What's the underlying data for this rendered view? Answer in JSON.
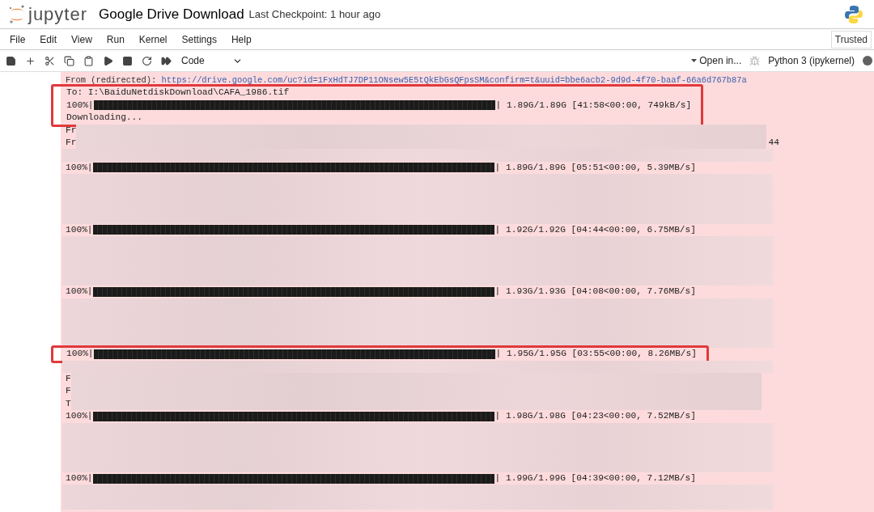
{
  "header": {
    "logo_text": "jupyter",
    "title": "Google Drive Download",
    "checkpoint": "Last Checkpoint: 1 hour ago"
  },
  "menu": [
    "File",
    "Edit",
    "View",
    "Run",
    "Kernel",
    "Settings",
    "Help"
  ],
  "trusted": "Trusted",
  "toolbar": {
    "cell_type": "Code",
    "open_in": "Open in...",
    "kernel": "Python 3 (ipykernel)",
    "kernel_busy": true
  },
  "output": [
    {
      "kind": "link",
      "prefix": "From (redirected): ",
      "url": "https://drive.google.com/uc?id=1FxHdTJ7DP11ONsew5E5tQkEbGsQFpsSM&confirm=t&uuid=bbe6acb2-9d9d-4f70-baaf-66a6d767b87a",
      "highlighted": false
    },
    {
      "kind": "text",
      "text": "To: I:\\BaiduNetdiskDownload\\CAFA_1986.tif",
      "highlighted": true
    },
    {
      "kind": "progress",
      "percent": "100%|",
      "level": 1,
      "stats": "| 1.89G/1.89G [41:58<00:00, 749kB/s]",
      "highlighted": true
    },
    {
      "kind": "text",
      "text": "Downloading...",
      "highlighted": true
    },
    {
      "kind": "partial",
      "text": "Fr",
      "highlighted": false
    },
    {
      "kind": "partial",
      "text": "Fr",
      "tail": "44",
      "highlighted": false
    },
    {
      "kind": "redacted",
      "highlighted": false
    },
    {
      "kind": "progress",
      "percent": "100%|",
      "level": 1,
      "stats": "| 1.89G/1.89G [05:51<00:00, 5.39MB/s]",
      "highlighted": false
    },
    {
      "kind": "redacted",
      "highlighted": false
    },
    {
      "kind": "redacted",
      "highlighted": false
    },
    {
      "kind": "redacted",
      "highlighted": false
    },
    {
      "kind": "redacted",
      "highlighted": false
    },
    {
      "kind": "progress",
      "percent": "100%|",
      "level": 1,
      "stats": "| 1.92G/1.92G [04:44<00:00, 6.75MB/s]",
      "highlighted": false
    },
    {
      "kind": "redacted",
      "highlighted": false
    },
    {
      "kind": "redacted",
      "highlighted": false
    },
    {
      "kind": "redacted",
      "highlighted": false
    },
    {
      "kind": "redacted",
      "highlighted": false
    },
    {
      "kind": "progress",
      "percent": "100%|",
      "level": 1,
      "stats": "| 1.93G/1.93G [04:08<00:00, 7.76MB/s]",
      "highlighted": false
    },
    {
      "kind": "redacted",
      "highlighted": false
    },
    {
      "kind": "redacted",
      "highlighted": false
    },
    {
      "kind": "redacted",
      "highlighted": false
    },
    {
      "kind": "redacted",
      "highlighted": false
    },
    {
      "kind": "progress",
      "percent": "100%|",
      "level": 1,
      "stats": "| 1.95G/1.95G [03:55<00:00, 8.26MB/s]",
      "highlighted": true
    },
    {
      "kind": "redacted",
      "highlighted": false
    },
    {
      "kind": "partial",
      "text": "F",
      "highlighted": false
    },
    {
      "kind": "partial",
      "text": "F",
      "highlighted": false
    },
    {
      "kind": "partial",
      "text": "T",
      "highlighted": false
    },
    {
      "kind": "progress",
      "percent": "100%|",
      "level": 1,
      "stats": "| 1.98G/1.98G [04:23<00:00, 7.52MB/s]",
      "highlighted": false
    },
    {
      "kind": "redacted",
      "highlighted": false
    },
    {
      "kind": "redacted",
      "highlighted": false
    },
    {
      "kind": "redacted",
      "highlighted": false
    },
    {
      "kind": "redacted",
      "highlighted": false
    },
    {
      "kind": "progress",
      "percent": "100%|",
      "level": 1,
      "stats": "| 1.99G/1.99G [04:39<00:00, 7.12MB/s]",
      "highlighted": false
    },
    {
      "kind": "redacted",
      "highlighted": false
    },
    {
      "kind": "redacted",
      "highlighted": false
    }
  ]
}
